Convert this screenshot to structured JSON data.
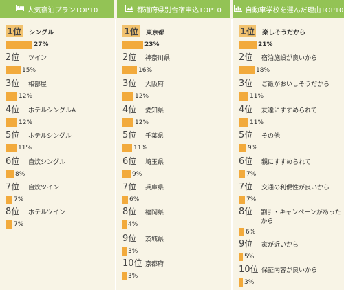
{
  "colors": {
    "header": "#93c355",
    "bar": "#f2aa3c",
    "top_highlight": "#f2c26e",
    "background": "#f8f4e6"
  },
  "rank_suffix": "位",
  "panels": [
    {
      "title": "人気宿泊プランTOP10",
      "icon": "bed-icon",
      "entries": [
        {
          "rank": "1",
          "label": "シングル",
          "pct": "27%",
          "value": 27
        },
        {
          "rank": "2",
          "label": "ツイン",
          "pct": "15%",
          "value": 15
        },
        {
          "rank": "3",
          "label": "相部屋",
          "pct": "12%",
          "value": 12
        },
        {
          "rank": "4",
          "label": "ホテルシングルA",
          "pct": "12%",
          "value": 12
        },
        {
          "rank": "5",
          "label": "ホテルシングル",
          "pct": "11%",
          "value": 11
        },
        {
          "rank": "6",
          "label": "自炊シングル",
          "pct": "8%",
          "value": 8
        },
        {
          "rank": "7",
          "label": "自炊ツイン",
          "pct": "7%",
          "value": 7
        },
        {
          "rank": "8",
          "label": "ホテルツイン",
          "pct": "7%",
          "value": 7
        }
      ]
    },
    {
      "title": "都道府県別合宿申込TOP10",
      "icon": "area-chart-icon",
      "entries": [
        {
          "rank": "1",
          "label": "東京都",
          "pct": "23%",
          "value": 23
        },
        {
          "rank": "2",
          "label": "神奈川県",
          "pct": "16%",
          "value": 16
        },
        {
          "rank": "3",
          "label": "大阪府",
          "pct": "12%",
          "value": 12
        },
        {
          "rank": "4",
          "label": "愛知県",
          "pct": "12%",
          "value": 12
        },
        {
          "rank": "5",
          "label": "千葉県",
          "pct": "11%",
          "value": 11
        },
        {
          "rank": "6",
          "label": "埼玉県",
          "pct": "9%",
          "value": 9
        },
        {
          "rank": "7",
          "label": "兵庫県",
          "pct": "6%",
          "value": 6
        },
        {
          "rank": "8",
          "label": "福岡県",
          "pct": "4%",
          "value": 4
        },
        {
          "rank": "9",
          "label": "茨城県",
          "pct": "3%",
          "value": 3
        },
        {
          "rank": "10",
          "label": "京都府",
          "pct": "3%",
          "value": 3
        }
      ]
    },
    {
      "title": "自動車学校を選んだ理由TOP10",
      "icon": "bar-chart-icon",
      "entries": [
        {
          "rank": "1",
          "label": "楽しそうだから",
          "pct": "21%",
          "value": 21
        },
        {
          "rank": "2",
          "label": "宿泊施設が良いから",
          "pct": "18%",
          "value": 18
        },
        {
          "rank": "3",
          "label": "ご飯がおいしそうだから",
          "pct": "11%",
          "value": 11
        },
        {
          "rank": "4",
          "label": "友達にすすめられて",
          "pct": "11%",
          "value": 11
        },
        {
          "rank": "5",
          "label": "その他",
          "pct": "9%",
          "value": 9
        },
        {
          "rank": "6",
          "label": "親にすすめられて",
          "pct": "7%",
          "value": 7
        },
        {
          "rank": "7",
          "label": "交通の利便性が良いから",
          "pct": "7%",
          "value": 7
        },
        {
          "rank": "8",
          "label": "割引・キャンペーンがあったから",
          "pct": "6%",
          "value": 6
        },
        {
          "rank": "9",
          "label": "家が近いから",
          "pct": "5%",
          "value": 5
        },
        {
          "rank": "10",
          "label": "保証内容が良いから",
          "pct": "3%",
          "value": 3
        }
      ]
    }
  ]
}
